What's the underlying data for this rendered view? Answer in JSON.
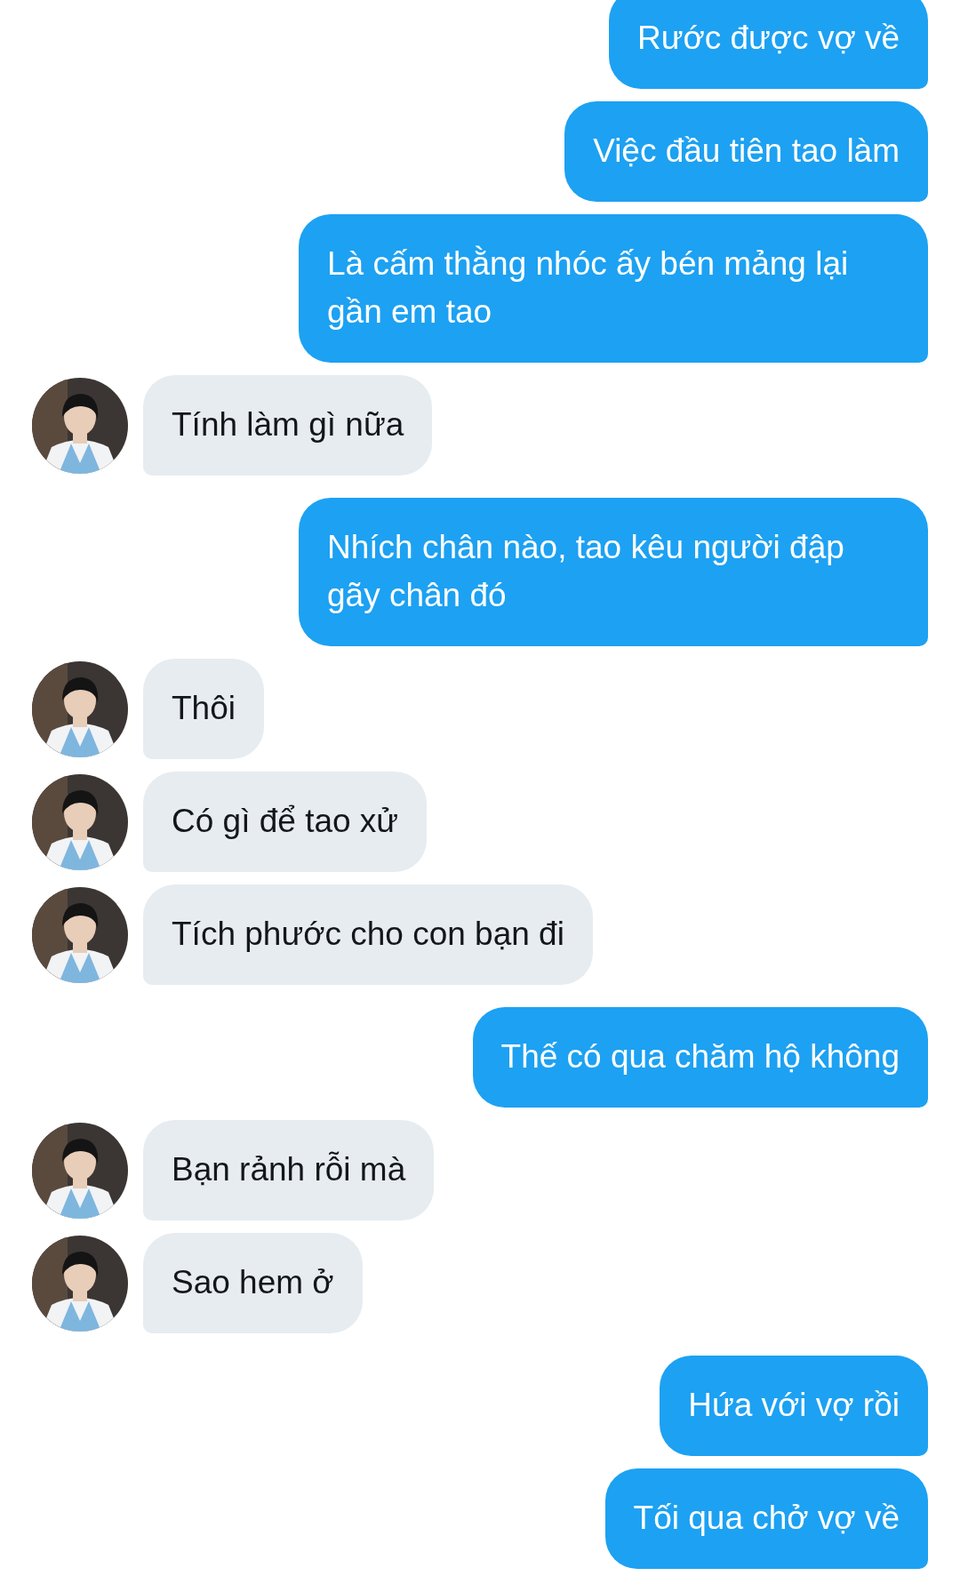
{
  "messages": [
    {
      "kind": "sent",
      "text": "Rước được vợ về"
    },
    {
      "kind": "sent",
      "text": "Việc đầu tiên tao làm"
    },
    {
      "kind": "sent",
      "text": "Là cấm thằng nhóc ấy bén mảng lại gần em tao"
    },
    {
      "kind": "received",
      "text": "Tính làm gì nữa"
    },
    {
      "kind": "sent",
      "text": "Nhích chân nào, tao kêu người đập gãy chân đó"
    },
    {
      "kind": "received",
      "text": "Thôi"
    },
    {
      "kind": "received",
      "text": "Có gì để tao xử"
    },
    {
      "kind": "received",
      "text": "Tích phước cho con bạn đi"
    },
    {
      "kind": "sent",
      "text": "Thế có qua chăm hộ không"
    },
    {
      "kind": "received",
      "text": "Bạn rảnh rỗi mà"
    },
    {
      "kind": "received",
      "text": "Sao hem ở"
    },
    {
      "kind": "sent",
      "text": "Hứa với vợ rồi"
    },
    {
      "kind": "sent",
      "text": "Tối qua chở vợ về"
    }
  ]
}
